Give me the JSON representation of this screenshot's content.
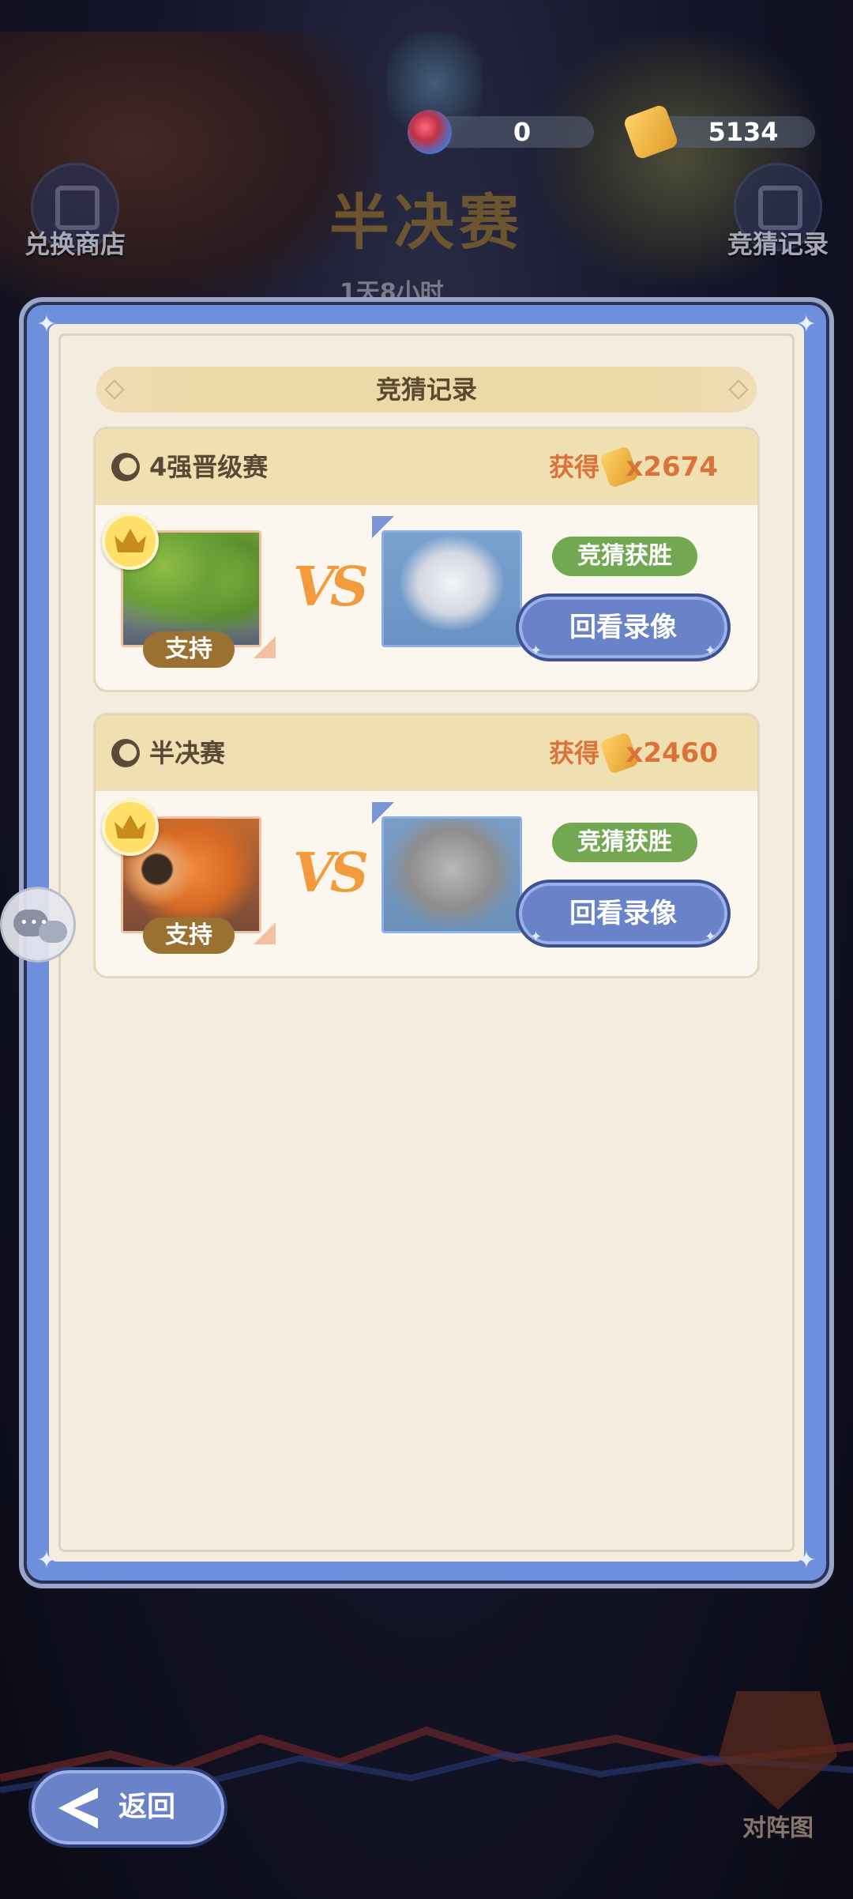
{
  "top_bar": {
    "gem_count": "0",
    "ticket_count": "5134"
  },
  "background": {
    "stage_title": "半决赛",
    "timer": "1天8小时",
    "shop_label": "兑换商店",
    "record_label": "竞猜记录",
    "formation_label": "对阵图"
  },
  "modal": {
    "title": "竞猜记录",
    "records": [
      {
        "round": "4强晋级赛",
        "earn_label": "获得",
        "earn_amount": "x2674",
        "support_label": "支持",
        "vs": "VS",
        "result": "竞猜获胜",
        "replay_label": "回看录像"
      },
      {
        "round": "半决赛",
        "earn_label": "获得",
        "earn_amount": "x2460",
        "support_label": "支持",
        "vs": "VS",
        "result": "竞猜获胜",
        "replay_label": "回看录像"
      }
    ]
  },
  "footer": {
    "back_label": "返回"
  },
  "colors": {
    "panel_frame": "#6e8fdc",
    "panel_bg": "#f4ecde",
    "earn_text": "#d9733a",
    "result_green": "#71a851",
    "replay_blue": "#6a82c8",
    "support_brown": "#9b7131"
  }
}
